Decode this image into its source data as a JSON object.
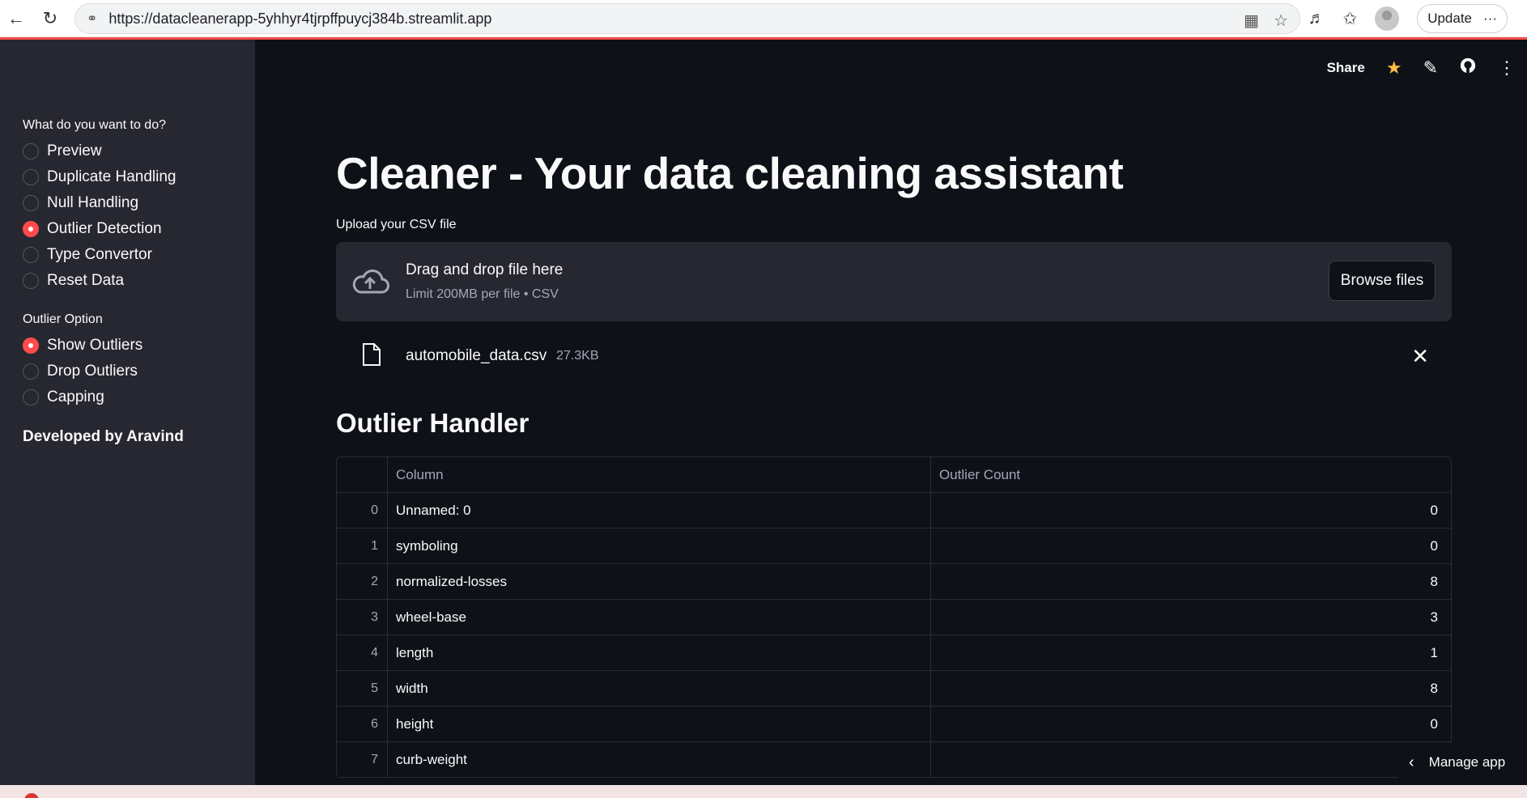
{
  "browser": {
    "url": "https://datacleanerapp-5yhhyr4tjrpffpuycj384b.streamlit.app",
    "update_label": "Update",
    "more_label": "···"
  },
  "sidebar": {
    "task_label": "What do you want to do?",
    "tasks": [
      {
        "label": "Preview",
        "selected": false
      },
      {
        "label": "Duplicate Handling",
        "selected": false
      },
      {
        "label": "Null Handling",
        "selected": false
      },
      {
        "label": "Outlier Detection",
        "selected": true
      },
      {
        "label": "Type Convertor",
        "selected": false
      },
      {
        "label": "Reset Data",
        "selected": false
      }
    ],
    "option_label": "Outlier Option",
    "options": [
      {
        "label": "Show Outliers",
        "selected": true
      },
      {
        "label": "Drop Outliers",
        "selected": false
      },
      {
        "label": "Capping",
        "selected": false
      }
    ],
    "credit": "Developed by Aravind"
  },
  "toolbar": {
    "share_label": "Share"
  },
  "main": {
    "title": "Cleaner - Your data cleaning assistant",
    "upload_label": "Upload your CSV file",
    "dropzone_title": "Drag and drop file here",
    "dropzone_sub": "Limit 200MB per file • CSV",
    "browse_label": "Browse files",
    "file_name": "automobile_data.csv",
    "file_size": "27.3KB",
    "section_title": "Outlier Handler",
    "table": {
      "columns": [
        "Column",
        "Outlier Count"
      ],
      "rows": [
        {
          "idx": "0",
          "col": "Unnamed: 0",
          "count": "0"
        },
        {
          "idx": "1",
          "col": "symboling",
          "count": "0"
        },
        {
          "idx": "2",
          "col": "normalized-losses",
          "count": "8"
        },
        {
          "idx": "3",
          "col": "wheel-base",
          "count": "3"
        },
        {
          "idx": "4",
          "col": "length",
          "count": "1"
        },
        {
          "idx": "5",
          "col": "width",
          "count": "8"
        },
        {
          "idx": "6",
          "col": "height",
          "count": "0"
        },
        {
          "idx": "7",
          "col": "curb-weight",
          "count": ""
        }
      ]
    },
    "manage_app_label": "Manage app"
  },
  "colors": {
    "accent": "#ff4b4b",
    "background": "#0e1117",
    "sidebar": "#262730",
    "star": "#ffbd45"
  }
}
